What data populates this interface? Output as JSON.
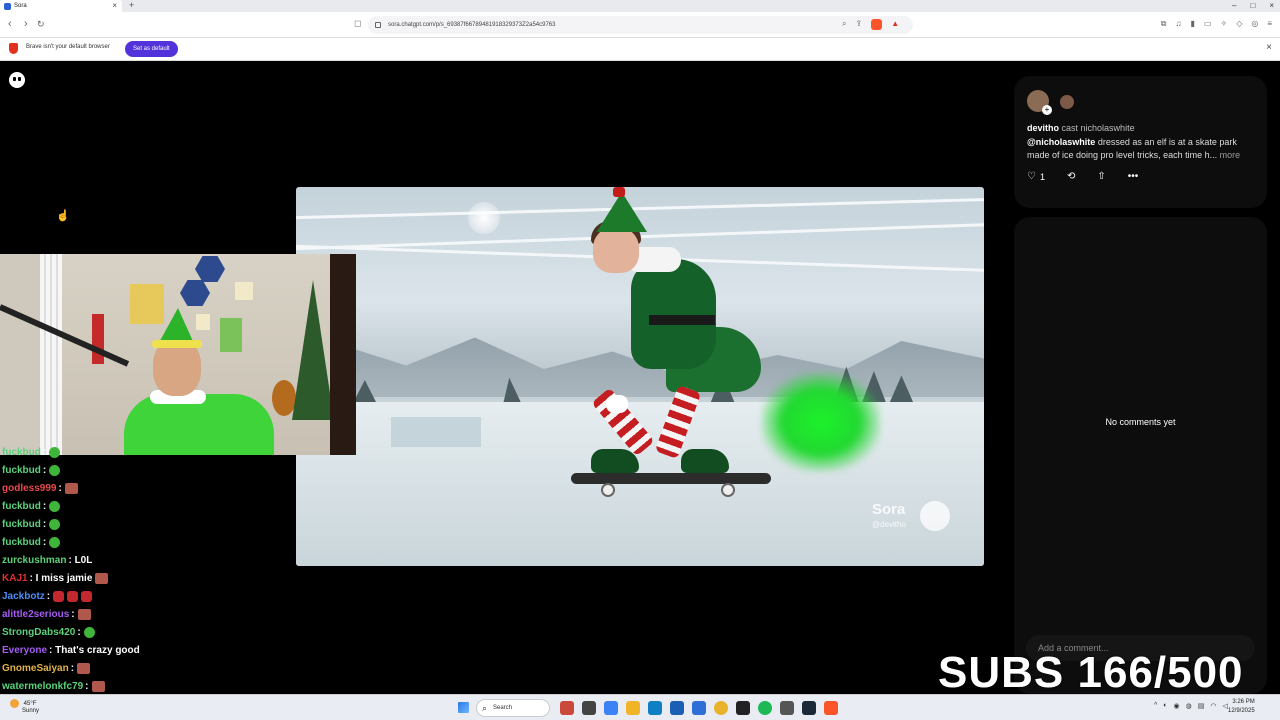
{
  "browser": {
    "tab_title": "Sora",
    "new_tab": "+",
    "url": "sora.chatgpt.com/p/s_69387f66789481918329373Z2a54c9763",
    "notice_text": "Brave isn't your default browser",
    "notice_button": "Set as default",
    "window_controls": [
      "–",
      "□",
      "×"
    ]
  },
  "video": {
    "watermark_name": "Sora",
    "watermark_handle": "@devitho"
  },
  "chat": {
    "messages": [
      {
        "user": "fuckbud",
        "color": "#5bd17a",
        "text": ":",
        "emotes": [
          "green"
        ]
      },
      {
        "user": "fuckbud",
        "color": "#5bd17a",
        "text": ":",
        "emotes": [
          "green"
        ]
      },
      {
        "user": "godless999",
        "color": "#e84b4b",
        "text": ":",
        "emotes": [
          "face"
        ]
      },
      {
        "user": "fuckbud",
        "color": "#5bd17a",
        "text": ":",
        "emotes": [
          "green"
        ]
      },
      {
        "user": "fuckbud",
        "color": "#5bd17a",
        "text": ":",
        "emotes": [
          "green"
        ]
      },
      {
        "user": "fuckbud",
        "color": "#5bd17a",
        "text": ":",
        "emotes": [
          "green"
        ]
      },
      {
        "user": "zurckushman",
        "color": "#5bd17a",
        "text": ": L0L",
        "emotes": []
      },
      {
        "user": "KAJ1",
        "color": "#e0302f",
        "text": ": I miss jamie",
        "emotes": [
          "face"
        ]
      },
      {
        "user": "Jackbotz",
        "color": "#4c8df6",
        "text": ":",
        "emotes": [
          "red",
          "red",
          "red"
        ]
      },
      {
        "user": "alittle2serious",
        "color": "#a45cf2",
        "text": ":",
        "emotes": [
          "face"
        ]
      },
      {
        "user": "StrongDabs420",
        "color": "#5bd17a",
        "text": ":",
        "emotes": [
          "green"
        ]
      },
      {
        "user": "Everyone",
        "color": "#a45cf2",
        "text": ": That's crazy good",
        "emotes": []
      },
      {
        "user": "GnomeSaiyan",
        "color": "#e0b24a",
        "text": ":",
        "emotes": [
          "face"
        ]
      },
      {
        "user": "watermelonkfc79",
        "color": "#5bd17a",
        "text": ":",
        "emotes": [
          "face"
        ]
      }
    ]
  },
  "post": {
    "username": "devitho",
    "cast_text": "cast nicholaswhite",
    "mention": "@nicholaswhite",
    "caption": "dressed as an elf is at a skate park made of ice doing pro level tricks, each time h...",
    "more": "more",
    "likes": "1"
  },
  "comments": {
    "empty": "No comments yet",
    "placeholder": "Add a comment..."
  },
  "overlay": {
    "subs": "SUBS 166/500"
  },
  "taskbar": {
    "search": "Search",
    "weather_temp": "45°F",
    "weather_desc": "Sunny",
    "time": "3:26 PM",
    "date": "12/9/2025"
  }
}
